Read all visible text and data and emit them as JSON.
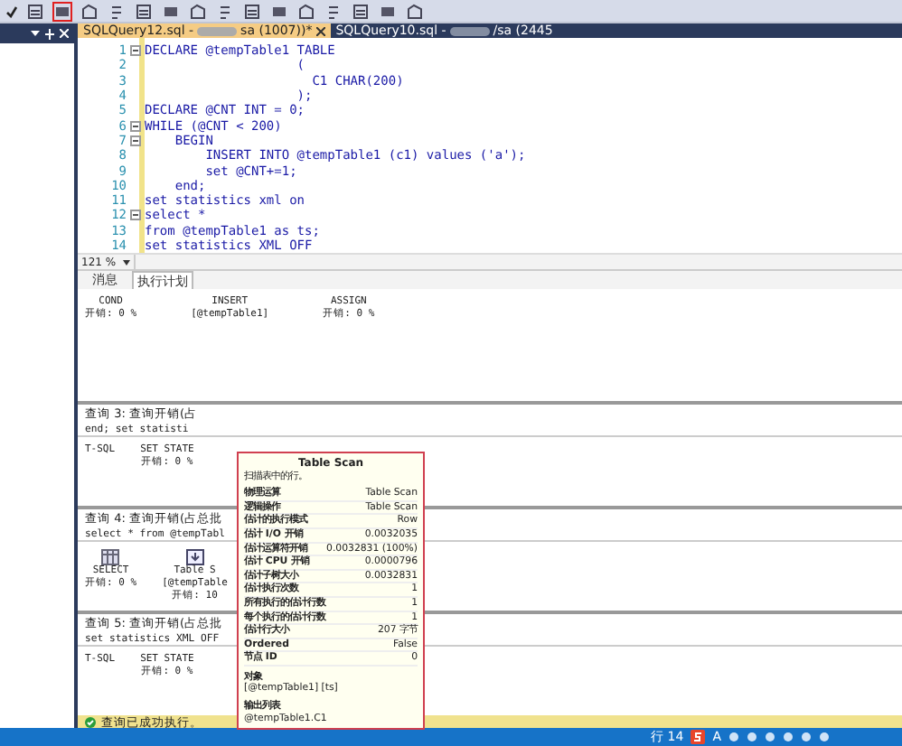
{
  "toolbar": {
    "buttons": [
      {
        "highlighted": false
      },
      {
        "highlighted": true
      },
      {
        "highlighted": false
      },
      {
        "highlighted": false
      },
      {
        "highlighted": false
      },
      {
        "highlighted": false
      },
      {
        "highlighted": false
      },
      {
        "highlighted": false
      },
      {
        "highlighted": false
      },
      {
        "highlighted": false
      },
      {
        "highlighted": false
      },
      {
        "highlighted": false
      },
      {
        "highlighted": false
      },
      {
        "highlighted": false
      },
      {
        "highlighted": false
      }
    ]
  },
  "editor_tabs": [
    {
      "title_start": "SQLQuery12.sql -",
      "title_end": "sa (1007))*",
      "selected": true
    },
    {
      "title_start": "SQLQuery10.sql -",
      "title_end": "/sa (2445",
      "selected": false
    }
  ],
  "editor": {
    "lines": [
      {
        "number": "1",
        "fold": true,
        "code": "DECLARE @tempTable1 TABLE"
      },
      {
        "number": "2",
        "fold": false,
        "code": "                    ("
      },
      {
        "number": "3",
        "fold": false,
        "code": "                      C1 CHAR(200)"
      },
      {
        "number": "4",
        "fold": false,
        "code": "                    );"
      },
      {
        "number": "5",
        "fold": false,
        "code": "DECLARE @CNT INT = 0;"
      },
      {
        "number": "6",
        "fold": true,
        "code": "WHILE (@CNT < 200)"
      },
      {
        "number": "7",
        "fold": true,
        "code": "    BEGIN"
      },
      {
        "number": "8",
        "fold": false,
        "code": "        INSERT INTO @tempTable1 (c1) values ('a');"
      },
      {
        "number": "9",
        "fold": false,
        "code": "        set @CNT+=1;"
      },
      {
        "number": "10",
        "fold": false,
        "code": "    end;"
      },
      {
        "number": "11",
        "fold": false,
        "code": "set statistics xml on"
      },
      {
        "number": "12",
        "fold": true,
        "code": "select *"
      },
      {
        "number": "13",
        "fold": false,
        "code": "from @tempTable1 as ts;"
      },
      {
        "number": "14",
        "fold": false,
        "code": "set statistics XML OFF"
      }
    ]
  },
  "zoom": "121 %",
  "result_tabs": [
    {
      "label": "消息",
      "selected": false
    },
    {
      "label": "执行计划",
      "selected": true
    }
  ],
  "plan": {
    "top_fragments": [
      {
        "name": "COND",
        "cost": "开销: 0 %"
      },
      {
        "name": "INSERT",
        "extra": "[@tempTable1]"
      },
      {
        "name": "ASSIGN",
        "cost": "开销: 0 %"
      }
    ],
    "queries": [
      {
        "header": "查询 3: 查询开销(占",
        "statement": "end; set statisti",
        "nodes": [
          {
            "kind": "tsql",
            "name": "T-SQL"
          },
          {
            "kind": "text",
            "name": "SET STATE",
            "cost": "开销: 0 %"
          }
        ]
      },
      {
        "header": "查询 4: 查询开销(占总批",
        "statement": "select * from @tempTabl",
        "nodes": [
          {
            "kind": "select",
            "name": "SELECT",
            "cost": "开销: 0 %"
          },
          {
            "kind": "scan",
            "name": "Table S",
            "cost": "开销: 10",
            "object": "[@tempTable"
          }
        ]
      },
      {
        "header": "查询 5: 查询开销(占总批",
        "statement": "set statistics XML OFF",
        "nodes": [
          {
            "kind": "tsql",
            "name": "T-SQL"
          },
          {
            "kind": "text",
            "name": "SET STATE",
            "cost": "开销: 0 %"
          }
        ]
      }
    ]
  },
  "tooltip": {
    "title": "Table Scan",
    "description": "扫描表中的行。",
    "rows": [
      {
        "label": "物理运算",
        "value": "Table Scan"
      },
      {
        "label": "逻辑操作",
        "value": "Table Scan"
      },
      {
        "label": "估计的执行模式",
        "value": "Row"
      },
      {
        "label": "估计 I/O 开销",
        "value": "0.0032035"
      },
      {
        "label": "估计运算符开销",
        "value": "0.0032831 (100%)"
      },
      {
        "label": "估计 CPU 开销",
        "value": "0.0000796"
      },
      {
        "label": "估计子树大小",
        "value": "0.0032831"
      },
      {
        "label": "估计执行次数",
        "value": "1"
      },
      {
        "label": "所有执行的估计行数",
        "value": "1"
      },
      {
        "label": "每个执行的估计行数",
        "value": "1"
      },
      {
        "label": "估计行大小",
        "value": "207 字节"
      },
      {
        "label": "Ordered",
        "value": "False"
      },
      {
        "label": "节点 ID",
        "value": "0"
      }
    ],
    "sections": [
      {
        "heading": "对象",
        "value": "[@tempTable1] [ts]"
      },
      {
        "heading": "输出列表",
        "value": "@tempTable1.C1"
      }
    ]
  },
  "status_bar": {
    "message": "查询已成功执行。"
  },
  "taskbar": {
    "position": "行 14",
    "ime_mode": "A"
  }
}
